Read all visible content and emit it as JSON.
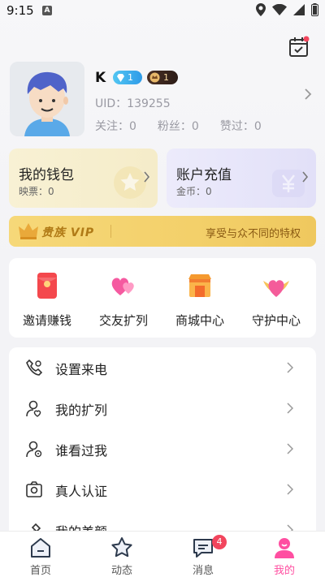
{
  "status_bar": {
    "time": "9:15"
  },
  "profile": {
    "nickname": "K",
    "level_badge": "1",
    "crown_badge": "1",
    "uid_label": "UID：",
    "uid_value": "139255",
    "stats": [
      {
        "label": "关注：",
        "value": "0"
      },
      {
        "label": "粉丝：",
        "value": "0"
      },
      {
        "label": "赞过：",
        "value": "0"
      }
    ]
  },
  "wallet": {
    "title": "我的钱包",
    "sub_label": "映票：",
    "sub_value": "0"
  },
  "recharge": {
    "title": "账户充值",
    "sub_label": "金币：",
    "sub_value": "0"
  },
  "vip": {
    "label": "贵族 VIP",
    "desc": "享受与众不同的特权"
  },
  "quick_actions": [
    {
      "label": "邀请赚钱",
      "icon": "red-envelope-icon"
    },
    {
      "label": "交友扩列",
      "icon": "hearts-icon"
    },
    {
      "label": "商城中心",
      "icon": "shop-icon"
    },
    {
      "label": "守护中心",
      "icon": "guard-heart-icon"
    }
  ],
  "menu": [
    {
      "label": "设置来电",
      "icon": "phone-settings-icon"
    },
    {
      "label": "我的扩列",
      "icon": "user-heart-icon"
    },
    {
      "label": "谁看过我",
      "icon": "user-eye-icon"
    },
    {
      "label": "真人认证",
      "icon": "camera-id-icon"
    },
    {
      "label": "我的美颜",
      "icon": "beauty-icon"
    }
  ],
  "tabs": [
    {
      "label": "首页",
      "icon": "home-icon"
    },
    {
      "label": "动态",
      "icon": "star-icon"
    },
    {
      "label": "消息",
      "icon": "chat-icon",
      "badge": "4"
    },
    {
      "label": "我的",
      "icon": "profile-icon",
      "active": true
    }
  ],
  "colors": {
    "accent": "#ff4fa1",
    "vip_gold": "#f3d06a",
    "badge_red": "#f2455d"
  }
}
